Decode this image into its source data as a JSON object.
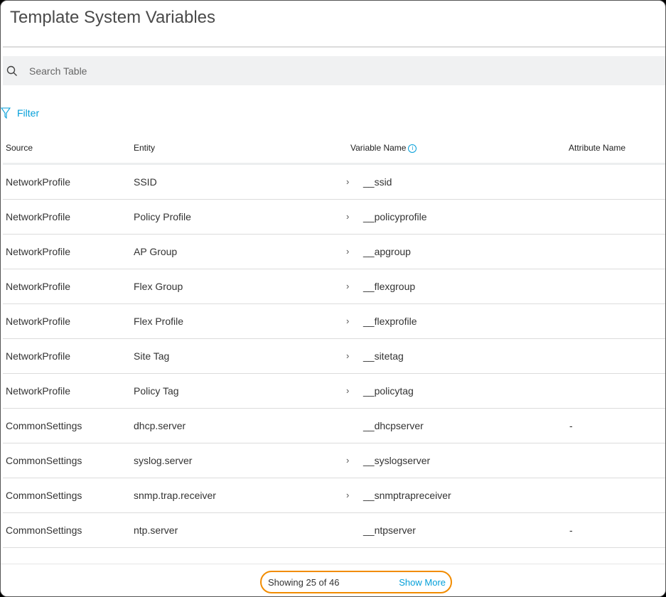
{
  "title": "Template System Variables",
  "search": {
    "placeholder": "Search Table",
    "icon": "search-icon"
  },
  "filter": {
    "label": "Filter",
    "icon": "filter-icon"
  },
  "columns": [
    "Source",
    "Entity",
    "Variable Name",
    "Attribute Name"
  ],
  "rows": [
    {
      "source": "NetworkProfile",
      "entity": "SSID",
      "variable": "__ssid",
      "expandable": true,
      "attribute": ""
    },
    {
      "source": "NetworkProfile",
      "entity": "Policy Profile",
      "variable": "__policyprofile",
      "expandable": true,
      "attribute": ""
    },
    {
      "source": "NetworkProfile",
      "entity": "AP Group",
      "variable": "__apgroup",
      "expandable": true,
      "attribute": ""
    },
    {
      "source": "NetworkProfile",
      "entity": "Flex Group",
      "variable": "__flexgroup",
      "expandable": true,
      "attribute": ""
    },
    {
      "source": "NetworkProfile",
      "entity": "Flex Profile",
      "variable": "__flexprofile",
      "expandable": true,
      "attribute": ""
    },
    {
      "source": "NetworkProfile",
      "entity": "Site Tag",
      "variable": "__sitetag",
      "expandable": true,
      "attribute": ""
    },
    {
      "source": "NetworkProfile",
      "entity": "Policy Tag",
      "variable": "__policytag",
      "expandable": true,
      "attribute": ""
    },
    {
      "source": "CommonSettings",
      "entity": "dhcp.server",
      "variable": "__dhcpserver",
      "expandable": false,
      "attribute": "-"
    },
    {
      "source": "CommonSettings",
      "entity": "syslog.server",
      "variable": "__syslogserver",
      "expandable": true,
      "attribute": ""
    },
    {
      "source": "CommonSettings",
      "entity": "snmp.trap.receiver",
      "variable": "__snmptrapreceiver",
      "expandable": true,
      "attribute": ""
    },
    {
      "source": "CommonSettings",
      "entity": "ntp.server",
      "variable": "__ntpserver",
      "expandable": false,
      "attribute": "-"
    }
  ],
  "footer": {
    "showing": "Showing 25 of 46",
    "show_more": "Show More"
  },
  "colors": {
    "accent": "#049fd9",
    "highlight": "#f28c00"
  }
}
